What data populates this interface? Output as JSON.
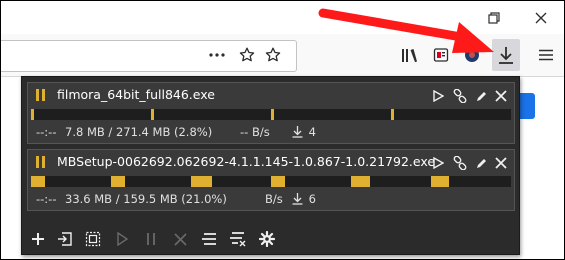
{
  "browser": {
    "toolbar_icons": [
      "more-icon",
      "bookmark-star-icon",
      "library-icon",
      "reader-icon",
      "extension-icon",
      "downloads-icon",
      "menu-icon"
    ],
    "window_controls": [
      "restore-icon",
      "close-icon"
    ]
  },
  "download_panel": {
    "items": [
      {
        "name": "filmora_64bit_full846.exe",
        "eta": "--:--",
        "size": "7.8 MB / 271.4 MB (2.8%)",
        "speed": "-- B/s",
        "connections": "4",
        "progress_percent": 2.8,
        "state": "paused"
      },
      {
        "name": "MBSetup-0062692.062692-4.1.1.145-1.0.867-1.0.21792.exe",
        "eta": "--:--",
        "size": "33.6 MB / 159.5 MB (21.0%)",
        "speed": "B/s",
        "connections": "6",
        "progress_percent": 21.0,
        "state": "paused"
      }
    ],
    "item_actions": [
      "play-icon",
      "link-icon",
      "edit-icon",
      "remove-icon"
    ],
    "footer_actions": [
      "add-icon",
      "import-icon",
      "select-all-icon",
      "resume-all-icon",
      "pause-all-icon",
      "cancel-all-icon",
      "clear-completed-icon",
      "clear-all-icon",
      "settings-icon"
    ]
  },
  "colors": {
    "panel_bg": "#2b2b2b",
    "progress": "#e0b030",
    "annotation_arrow": "#ff1a1a"
  }
}
